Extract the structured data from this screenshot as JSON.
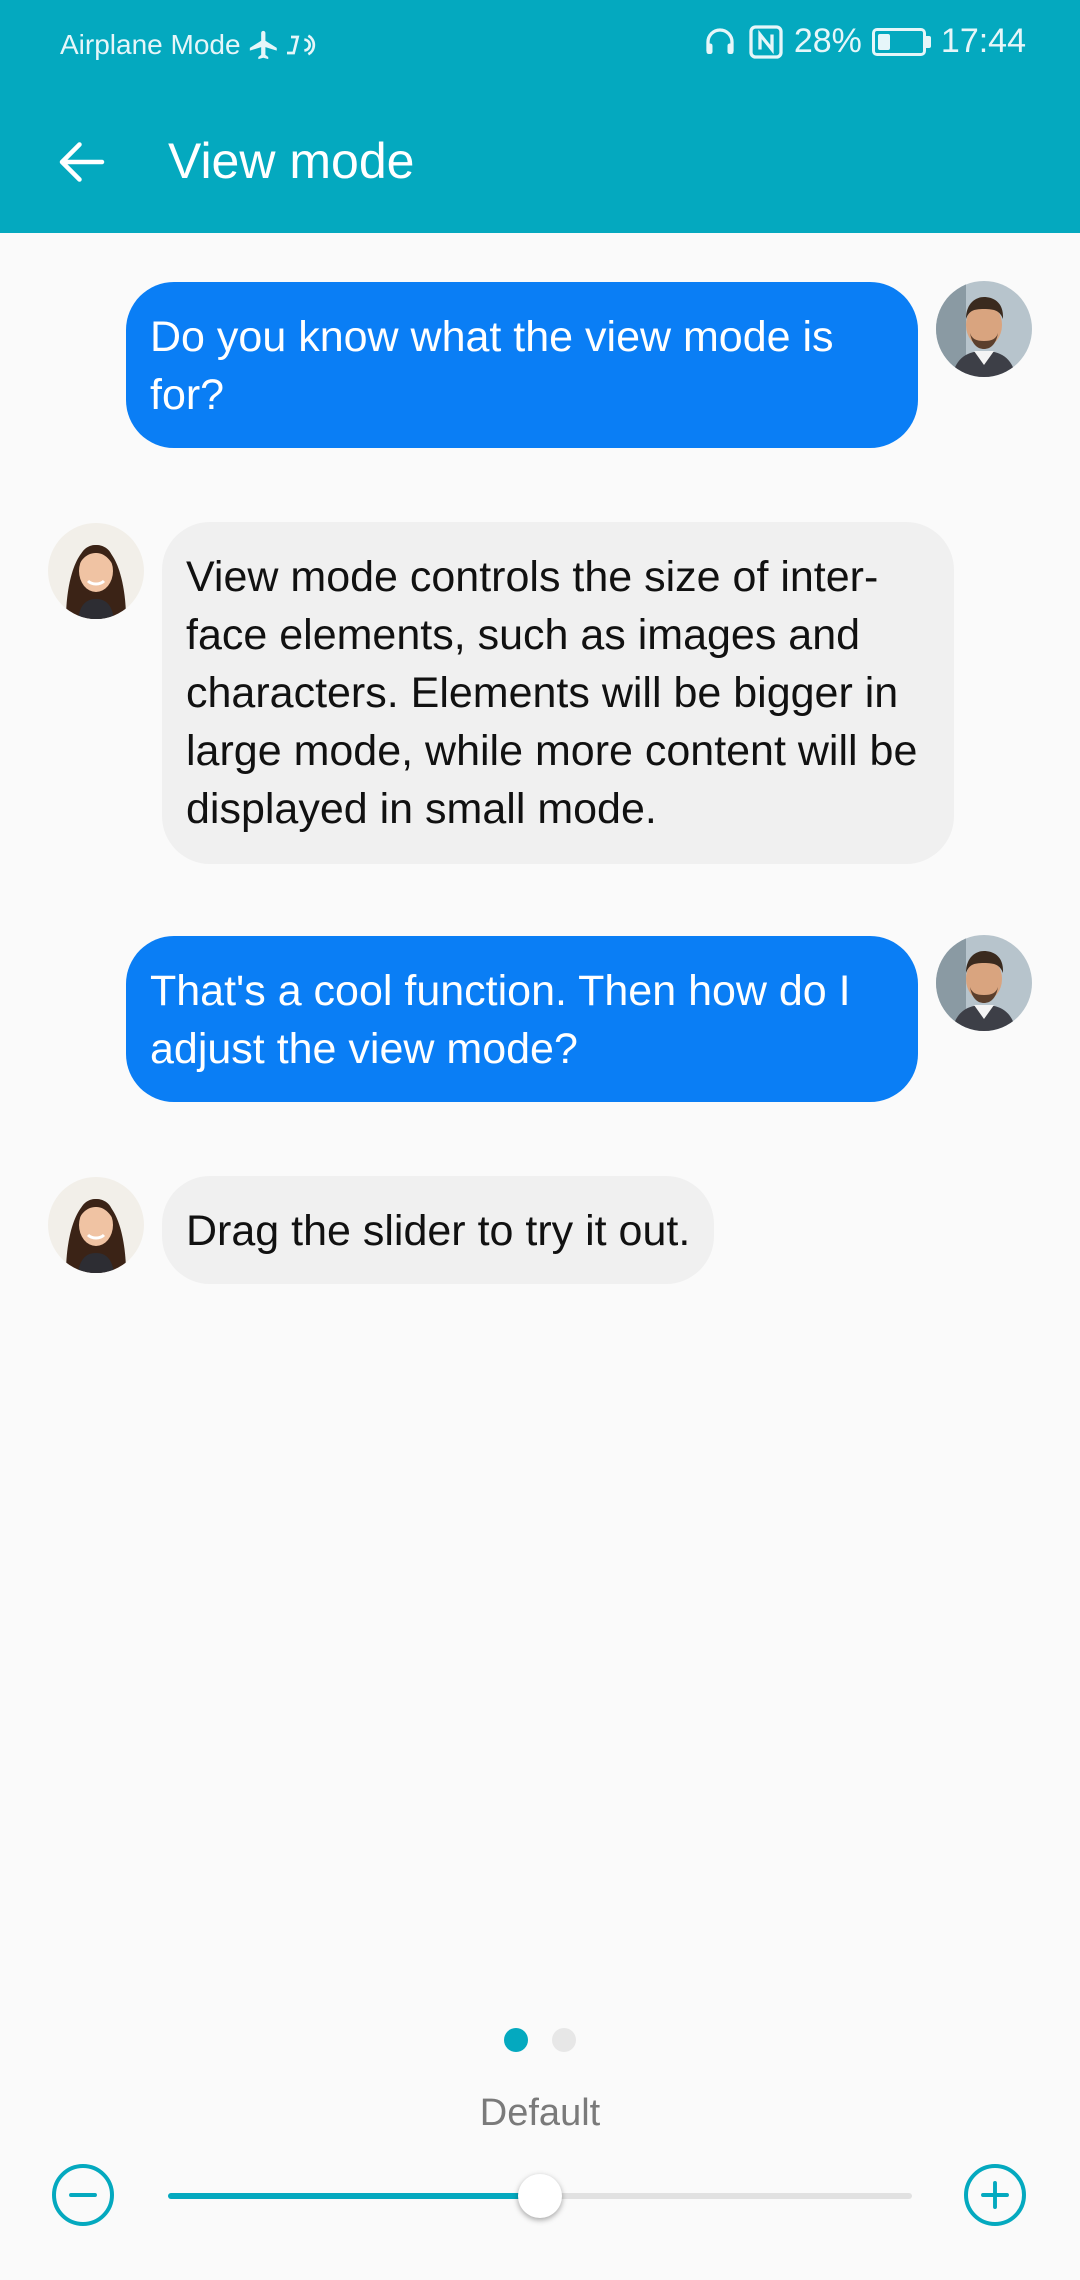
{
  "status_bar": {
    "mode_label": "Airplane Mode",
    "battery": "28%",
    "time": "17:44",
    "icons": [
      "airplane-icon",
      "wifi-calling-icon",
      "headphones-icon",
      "nfc-icon",
      "battery-icon"
    ]
  },
  "toolbar": {
    "back_icon": "arrow-back-icon",
    "title": "View mode"
  },
  "chat": {
    "messages": [
      {
        "from": "user",
        "text": "Do you know what the view mode is for?"
      },
      {
        "from": "assistant",
        "text": "View mode controls the size of inter-face elements, such as images and characters. Elements will be bigger in large mode, while more content will be displayed in small mode."
      },
      {
        "from": "user",
        "text": "That's a cool function. Then how do I adjust the view mode?"
      },
      {
        "from": "assistant",
        "text": "Drag the slider to try it out."
      }
    ]
  },
  "pager": {
    "pages": 2,
    "current": 1
  },
  "view_mode": {
    "label": "Default",
    "slider_value": 0.5,
    "decrease_icon": "minus-circle-icon",
    "increase_icon": "plus-circle-icon"
  },
  "colors": {
    "accent": "#04a9bf",
    "user_bubble": "#0a7ef5",
    "assistant_bubble": "#f0f0f0"
  }
}
